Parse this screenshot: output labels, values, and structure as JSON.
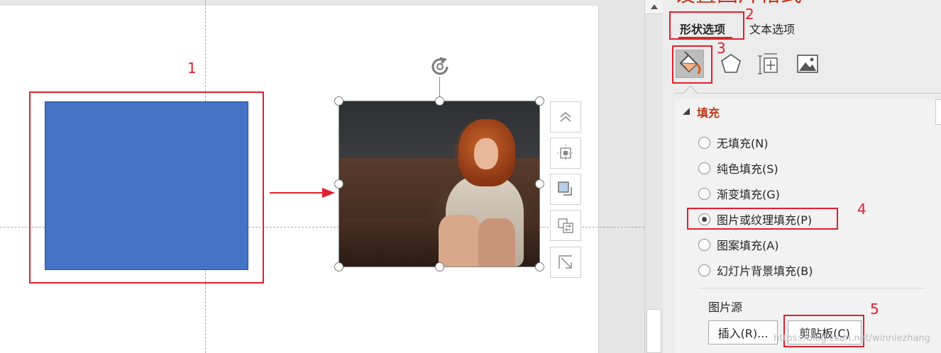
{
  "pane": {
    "title": "设置图片格式",
    "tabs": {
      "shape_options": "形状选项",
      "text_options": "文本选项"
    },
    "categories": [
      "fill-line-icon",
      "effects-pentagon-icon",
      "size-properties-icon",
      "picture-icon"
    ],
    "section": {
      "title": "填充",
      "options": [
        {
          "label": "无填充(N)",
          "checked": false
        },
        {
          "label": "纯色填充(S)",
          "checked": false
        },
        {
          "label": "渐变填充(G)",
          "checked": false
        },
        {
          "label": "图片或纹理填充(P)",
          "checked": true
        },
        {
          "label": "图案填充(A)",
          "checked": false
        },
        {
          "label": "幻灯片背景填充(B)",
          "checked": false
        }
      ]
    },
    "picture_source": {
      "label": "图片源",
      "insert_button": "插入(R)...",
      "clipboard_button": "剪贴板(C)"
    }
  },
  "annotations": {
    "n1": "1",
    "n2": "2",
    "n3": "3",
    "n4": "4",
    "n5": "5",
    "color": "#e0202e"
  },
  "colors": {
    "shape_fill": "#4472c4",
    "accent": "#c0391b"
  },
  "floating_tools": [
    "layout-options-icon",
    "align-center-icon",
    "crop-overlap-icon",
    "arrange-icon",
    "resize-icon"
  ],
  "watermark": "https://blog.csdn.net/winniezhang"
}
